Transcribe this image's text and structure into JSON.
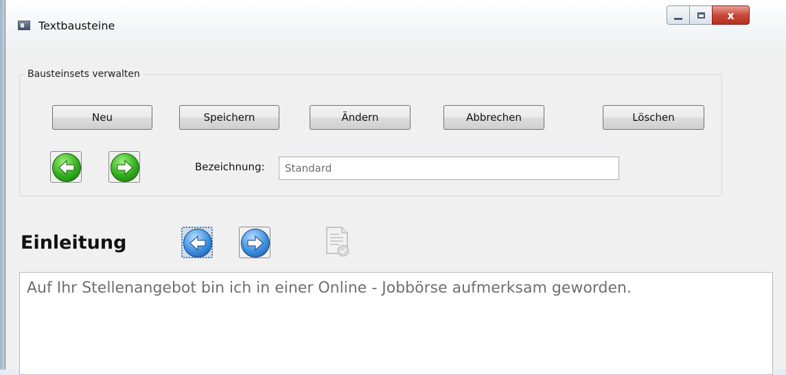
{
  "window": {
    "title": "Textbausteine",
    "controls": {
      "minimize": "minimize",
      "maximize": "maximize",
      "close": "x"
    }
  },
  "group": {
    "label": "Bausteinsets verwalten",
    "buttons": {
      "new": "Neu",
      "save": "Speichern",
      "change": "Ändern",
      "cancel": "Abbrechen",
      "delete": "Löschen"
    },
    "nav": {
      "previous_icon": "arrow-left-green",
      "next_icon": "arrow-right-green"
    },
    "designation": {
      "label": "Bezeichnung:",
      "value": "Standard"
    }
  },
  "section": {
    "title": "Einleitung",
    "nav": {
      "previous_icon": "arrow-left-blue",
      "next_icon": "arrow-right-blue",
      "doc_icon": "document-check"
    },
    "text": "Auf Ihr Stellenangebot bin ich in einer Online - Jobbörse aufmerksam geworden."
  },
  "colors": {
    "window_bg": "#f0f0f0",
    "close_red": "#c9483a",
    "nav_green": "#2fae1d",
    "nav_blue": "#3b8fe0"
  }
}
